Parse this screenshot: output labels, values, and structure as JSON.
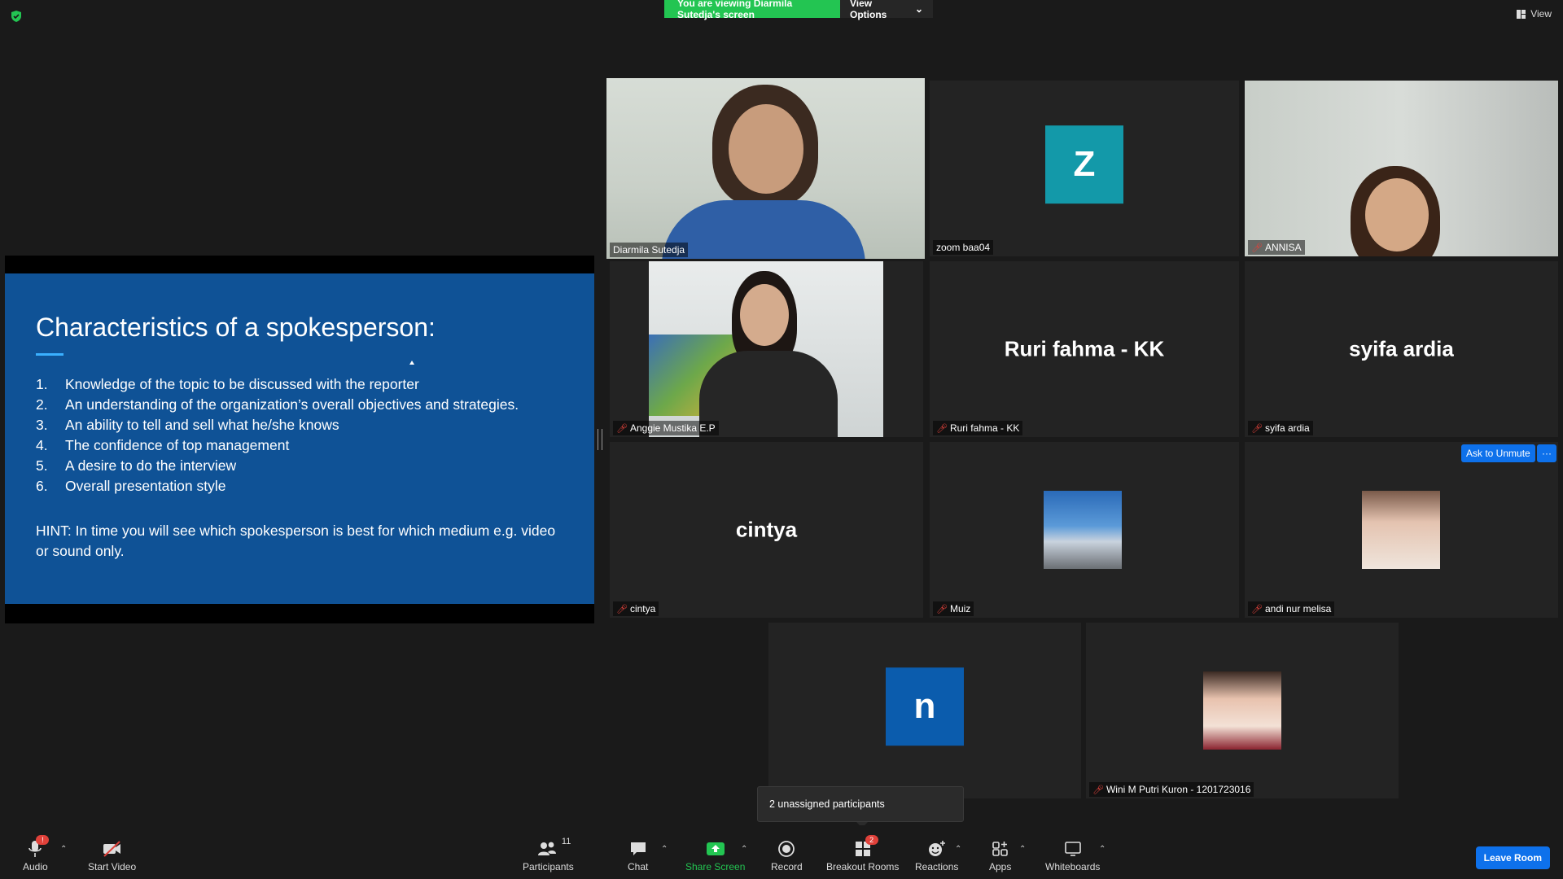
{
  "banner": {
    "viewing_text": "You are viewing Diarmila Sutedja's screen",
    "view_options": "View Options"
  },
  "view_button": "View",
  "slide": {
    "title": "Characteristics of a spokesperson:",
    "items": [
      {
        "num": "1.",
        "text": "Knowledge of the topic to be discussed with the reporter"
      },
      {
        "num": "2.",
        "text": "An understanding of the organization’s overall objectives and strategies."
      },
      {
        "num": "3.",
        "text": "An ability to tell and sell what he/she knows"
      },
      {
        "num": "4.",
        "text": "The confidence of top management"
      },
      {
        "num": "5.",
        "text": "A desire to do the interview"
      },
      {
        "num": "6.",
        "text": "Overall presentation style"
      }
    ],
    "hint": "HINT: In time you will see which spokesperson is best for which medium e.g. video or sound only."
  },
  "participants": {
    "diarmila": {
      "name": "Diarmila Sutedja"
    },
    "zoom": {
      "name": "zoom baa04",
      "avatar": "Z",
      "avatar_color": "#1399a9"
    },
    "annisa": {
      "name": "ANNISA"
    },
    "anggie": {
      "name": "Anggie Mustika E.P"
    },
    "ruri": {
      "name": "Ruri fahma - KK",
      "big": "Ruri fahma - KK"
    },
    "syifa": {
      "name": "syifa ardia",
      "big": "syifa ardia"
    },
    "cintya": {
      "name": "cintya",
      "big": "cintya"
    },
    "muiz": {
      "name": "Muiz"
    },
    "andi": {
      "name": "andi nur melisa"
    },
    "n": {
      "avatar": "n",
      "avatar_color": "#0b5cad"
    },
    "wini": {
      "name": "Wini M Putri Kuron - 1201723016"
    }
  },
  "ask_unmute": "Ask to Unmute",
  "more": "···",
  "tooltip": "2 unassigned participants",
  "toolbar": {
    "audio": "Audio",
    "audio_badge": "!",
    "start_video": "Start Video",
    "participants": "Participants",
    "participants_count": "11",
    "chat": "Chat",
    "share_screen": "Share Screen",
    "record": "Record",
    "breakout": "Breakout Rooms",
    "breakout_badge": "2",
    "reactions": "Reactions",
    "apps": "Apps",
    "whiteboards": "Whiteboards",
    "leave": "Leave Room"
  },
  "colors": {
    "accent_green": "#23c552",
    "accent_blue": "#0e71eb",
    "slide_bg": "#0f5296",
    "active_speaker": "#e9f26b"
  }
}
